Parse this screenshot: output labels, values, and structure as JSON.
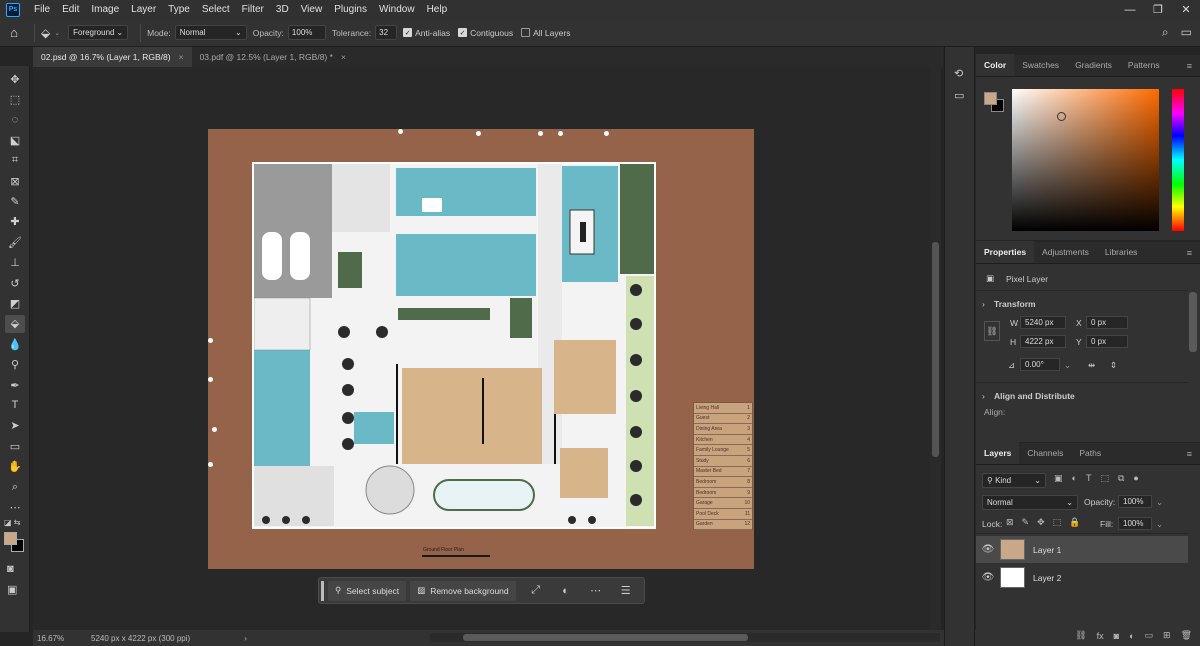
{
  "app": {
    "logo": "Ps"
  },
  "menu": [
    "File",
    "Edit",
    "Image",
    "Layer",
    "Type",
    "Select",
    "Filter",
    "3D",
    "View",
    "Plugins",
    "Window",
    "Help"
  ],
  "window_controls": {
    "minimize": "—",
    "restore": "❐",
    "close": "✕"
  },
  "options": {
    "fill_source": "Foreground",
    "mode_label": "Mode:",
    "mode_value": "Normal",
    "opacity_label": "Opacity:",
    "opacity_value": "100%",
    "tolerance_label": "Tolerance:",
    "tolerance_value": "32",
    "antialias_label": "Anti-alias",
    "antialias_checked": true,
    "contiguous_label": "Contiguous",
    "contiguous_checked": true,
    "all_layers_label": "All Layers",
    "all_layers_checked": false
  },
  "tabs": [
    {
      "label": "02.psd @ 16.7% (Layer 1, RGB/8)",
      "close": "×",
      "active": true
    },
    {
      "label": "03.pdf @ 12.5% (Layer 1, RGB/8) *",
      "close": "×",
      "active": false
    }
  ],
  "tools": [
    {
      "name": "move-tool",
      "glyph": "✥"
    },
    {
      "name": "marquee-tool",
      "glyph": "⬚"
    },
    {
      "name": "lasso-tool",
      "glyph": "◌"
    },
    {
      "name": "object-selection-tool",
      "glyph": "⬕"
    },
    {
      "name": "crop-tool",
      "glyph": "⌗"
    },
    {
      "name": "frame-tool",
      "glyph": "⊠"
    },
    {
      "name": "eyedropper-tool",
      "glyph": "✎"
    },
    {
      "name": "healing-brush-tool",
      "glyph": "✚"
    },
    {
      "name": "brush-tool",
      "glyph": "🖌"
    },
    {
      "name": "clone-stamp-tool",
      "glyph": "⊥"
    },
    {
      "name": "history-brush-tool",
      "glyph": "↺"
    },
    {
      "name": "eraser-tool",
      "glyph": "◩"
    },
    {
      "name": "paint-bucket-tool",
      "glyph": "⬙",
      "active": true
    },
    {
      "name": "blur-tool",
      "glyph": "💧"
    },
    {
      "name": "dodge-tool",
      "glyph": "⚲"
    },
    {
      "name": "pen-tool",
      "glyph": "✒"
    },
    {
      "name": "type-tool",
      "glyph": "T"
    },
    {
      "name": "path-selection-tool",
      "glyph": "➤"
    },
    {
      "name": "rectangle-tool",
      "glyph": "▭"
    },
    {
      "name": "hand-tool",
      "glyph": "✋"
    },
    {
      "name": "zoom-tool",
      "glyph": "⌕"
    },
    {
      "name": "more-tools",
      "glyph": "⋯"
    }
  ],
  "legend": [
    {
      "name": "Living Hall",
      "num": "1"
    },
    {
      "name": "Guest",
      "num": "2"
    },
    {
      "name": "Dining Area",
      "num": "3"
    },
    {
      "name": "Kitchen",
      "num": "4"
    },
    {
      "name": "Family Lounge",
      "num": "5"
    },
    {
      "name": "Study",
      "num": "6"
    },
    {
      "name": "Master Bed",
      "num": "7"
    },
    {
      "name": "Bedroom",
      "num": "8"
    },
    {
      "name": "Bedroom",
      "num": "9"
    },
    {
      "name": "Garage",
      "num": "10"
    },
    {
      "name": "Pool Deck",
      "num": "11"
    },
    {
      "name": "Garden",
      "num": "12"
    }
  ],
  "plan_caption": "Ground Floor Plan",
  "taskbar": {
    "select_subject": "Select subject",
    "remove_background": "Remove background"
  },
  "status": {
    "zoom": "16.67%",
    "doc_info": "5240 px x 4222 px (300 ppi)",
    "arrow": "›"
  },
  "color_panel": {
    "tabs": [
      "Color",
      "Swatches",
      "Gradients",
      "Patterns"
    ],
    "foreground": "#c9a789",
    "background": "#000000",
    "hue": "#ff6a00"
  },
  "properties": {
    "tabs": [
      "Properties",
      "Adjustments",
      "Libraries"
    ],
    "kind": "Pixel Layer",
    "transform_label": "Transform",
    "w_label": "W",
    "w_value": "5240 px",
    "h_label": "H",
    "h_value": "4222 px",
    "x_label": "X",
    "x_value": "0 px",
    "y_label": "Y",
    "y_value": "0 px",
    "angle_value": "0.00°",
    "align_label": "Align and Distribute",
    "align_sub": "Align:"
  },
  "layers": {
    "tabs": [
      "Layers",
      "Channels",
      "Paths"
    ],
    "filter_kind": "Kind",
    "blend_mode": "Normal",
    "opacity_label": "Opacity:",
    "opacity_value": "100%",
    "lock_label": "Lock:",
    "fill_label": "Fill:",
    "fill_value": "100%",
    "items": [
      {
        "name": "Layer 1",
        "selected": true
      },
      {
        "name": "Layer 2",
        "selected": false
      }
    ]
  }
}
